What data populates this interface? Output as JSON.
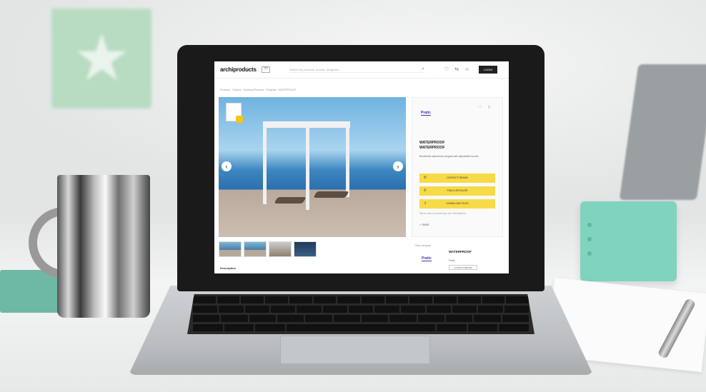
{
  "site": {
    "logo": "archiproducts",
    "logo_badge": "??",
    "search_placeholder": "Search for products, brands, designers...",
    "search_icon": "search-icon",
    "top_icons": "♡ ⇆ ☺",
    "login_label": "LOGIN",
    "breadcrumb": "Products · Outdoor · Gazebos/Pergolas · Pergolas · WATERPROOF"
  },
  "product": {
    "brand": "Pratic",
    "title_line1": "WATERPROOF",
    "title_line2": "WATERPROOF",
    "description": "Bioclimatic aluminium pergola with adjustable louvres",
    "cta": [
      {
        "icon": "phone-icon",
        "label": "CONTACT BRAND"
      },
      {
        "icon": "pin-icon",
        "label": "FIND A RETAILER"
      },
      {
        "icon": "download-icon",
        "label": "DOWNLOAD FILES"
      }
    ],
    "note": "Tell us which product you are interested in",
    "extra": "+ SAVE",
    "thumb_section": "Description"
  },
  "related": {
    "label": "Other pergolas",
    "brand": "Pratic",
    "title": "WATERPROOF",
    "subtitle": "Pratic",
    "button": "CONTACT BRAND"
  },
  "hero": {
    "prev_arrow": "‹",
    "next_arrow": "›"
  }
}
